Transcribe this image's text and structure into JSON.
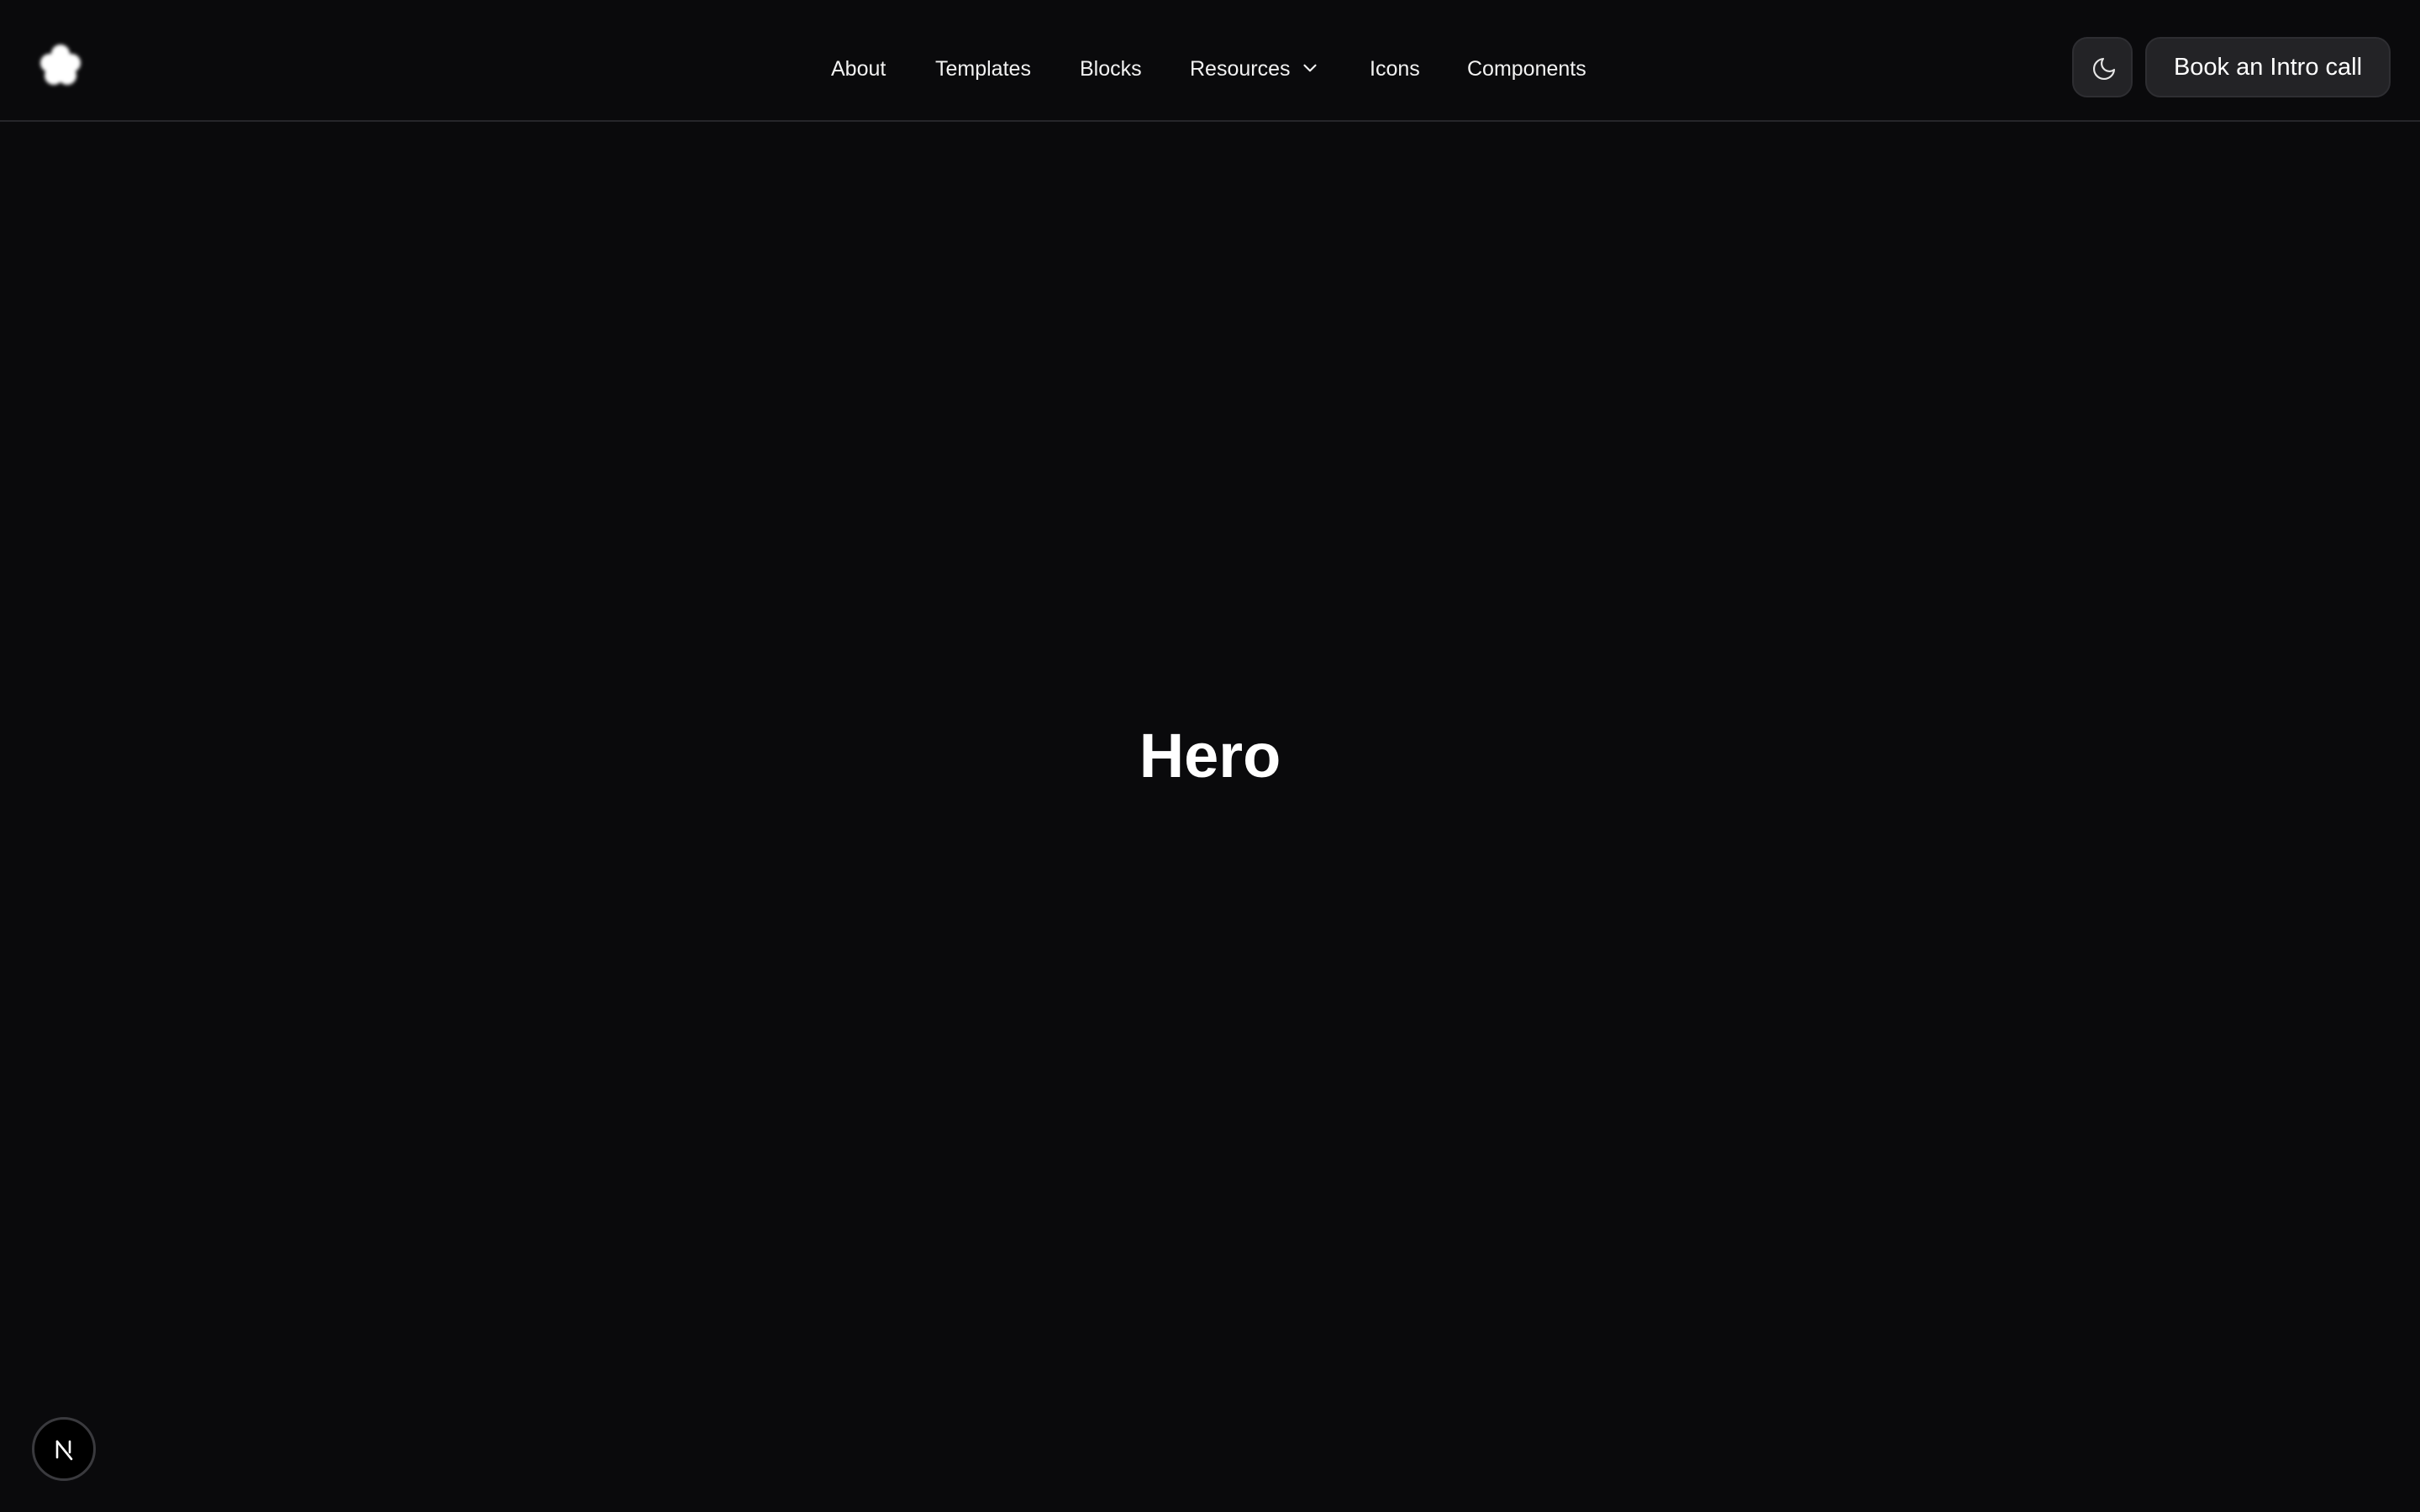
{
  "header": {
    "logo": {
      "icon": "flower-logo-icon"
    },
    "nav": {
      "items": [
        {
          "label": "About"
        },
        {
          "label": "Templates"
        },
        {
          "label": "Blocks"
        },
        {
          "label": "Resources",
          "icon": "chevron-down-icon"
        },
        {
          "label": "Icons"
        },
        {
          "label": "Components"
        }
      ]
    },
    "theme_toggle": {
      "icon": "moon-icon"
    },
    "cta_label": "Book an Intro call"
  },
  "main": {
    "hero_title": "Hero"
  },
  "dev_badge": {
    "icon": "nextjs-logo-icon",
    "letter": "N"
  },
  "colors": {
    "background": "#0a0a0c",
    "surface": "#232326",
    "text": "#ffffff",
    "border": "#26262a"
  }
}
